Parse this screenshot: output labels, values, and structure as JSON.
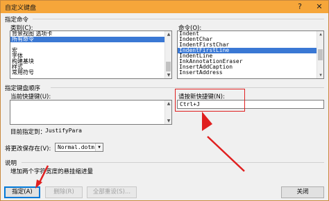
{
  "window": {
    "title": "自定义键盘",
    "help_glyph": "?",
    "close_glyph": "✕",
    "accent_color": "#f6a63a"
  },
  "specify_command": {
    "group_label": "指定命令",
    "categories_label": "类别(C):",
    "categories": [
      {
        "label": "背景视图 选项卡",
        "selected": false
      },
      {
        "label": "所有命令",
        "selected": true
      },
      {
        "label": "",
        "selected": false
      },
      {
        "label": "宏",
        "selected": false
      },
      {
        "label": "字体",
        "selected": false
      },
      {
        "label": "构建基块",
        "selected": false
      },
      {
        "label": "样式",
        "selected": false
      },
      {
        "label": "常用符号",
        "selected": false
      }
    ],
    "commands_label": "命令(O):",
    "commands": [
      {
        "label": "Indent",
        "selected": false
      },
      {
        "label": "IndentChar",
        "selected": false
      },
      {
        "label": "IndentFirstChar",
        "selected": false
      },
      {
        "label": "IndentFirstLine",
        "selected": true
      },
      {
        "label": "IndentLine",
        "selected": false
      },
      {
        "label": "InkAnnotationEraser",
        "selected": false
      },
      {
        "label": "InsertAddCaption",
        "selected": false
      },
      {
        "label": "InsertAddress",
        "selected": false
      }
    ]
  },
  "keyboard_sequence": {
    "group_label": "指定键盘顺序",
    "current_keys_label": "当前快捷键(U):",
    "new_key_label": "请按新快捷键(N):",
    "new_key_value": "Ctrl+J",
    "currently_assigned_label": "目前指定到：",
    "currently_assigned_value": "JustifyPara"
  },
  "save_changes": {
    "label": "将更改保存在(V):",
    "value": "Normal.dotm"
  },
  "description": {
    "group_label": "说明",
    "text": "增加两个字符宽度的悬挂缩进量"
  },
  "buttons": {
    "assign": "指定(A)",
    "remove": "删除(R)",
    "reset_all": "全部重设(S)...",
    "close": "关闭"
  },
  "annotation_color": "#e02020"
}
